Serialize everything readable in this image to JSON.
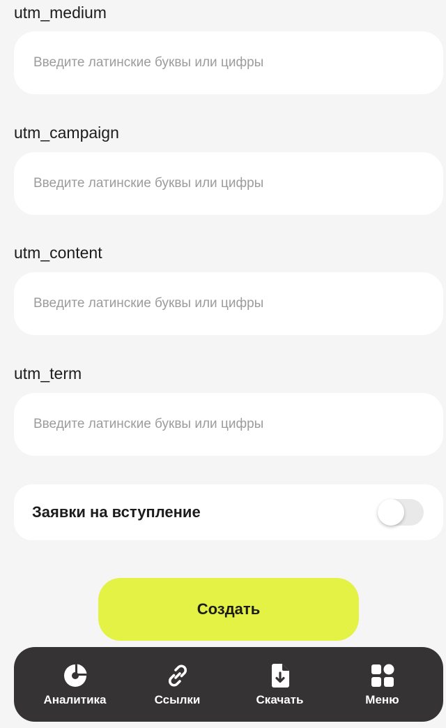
{
  "fields": [
    {
      "label": "utm_medium",
      "placeholder": "Введите латинские буквы или цифры",
      "value": ""
    },
    {
      "label": "utm_campaign",
      "placeholder": "Введите латинские буквы или цифры",
      "value": ""
    },
    {
      "label": "utm_content",
      "placeholder": "Введите латинские буквы или цифры",
      "value": ""
    },
    {
      "label": "utm_term",
      "placeholder": "Введите латинские буквы или цифры",
      "value": ""
    }
  ],
  "join_requests": {
    "label": "Заявки на вступление",
    "enabled": false
  },
  "create_button": {
    "label": "Создать"
  },
  "nav": {
    "items": [
      {
        "label": "Аналитика",
        "icon": "pie-chart-icon"
      },
      {
        "label": "Ссылки",
        "icon": "link-icon"
      },
      {
        "label": "Скачать",
        "icon": "download-file-icon"
      },
      {
        "label": "Меню",
        "icon": "grid-menu-icon"
      }
    ]
  },
  "colors": {
    "background": "#f5f5f5",
    "accent": "#e3f244",
    "nav_background": "#363334"
  }
}
